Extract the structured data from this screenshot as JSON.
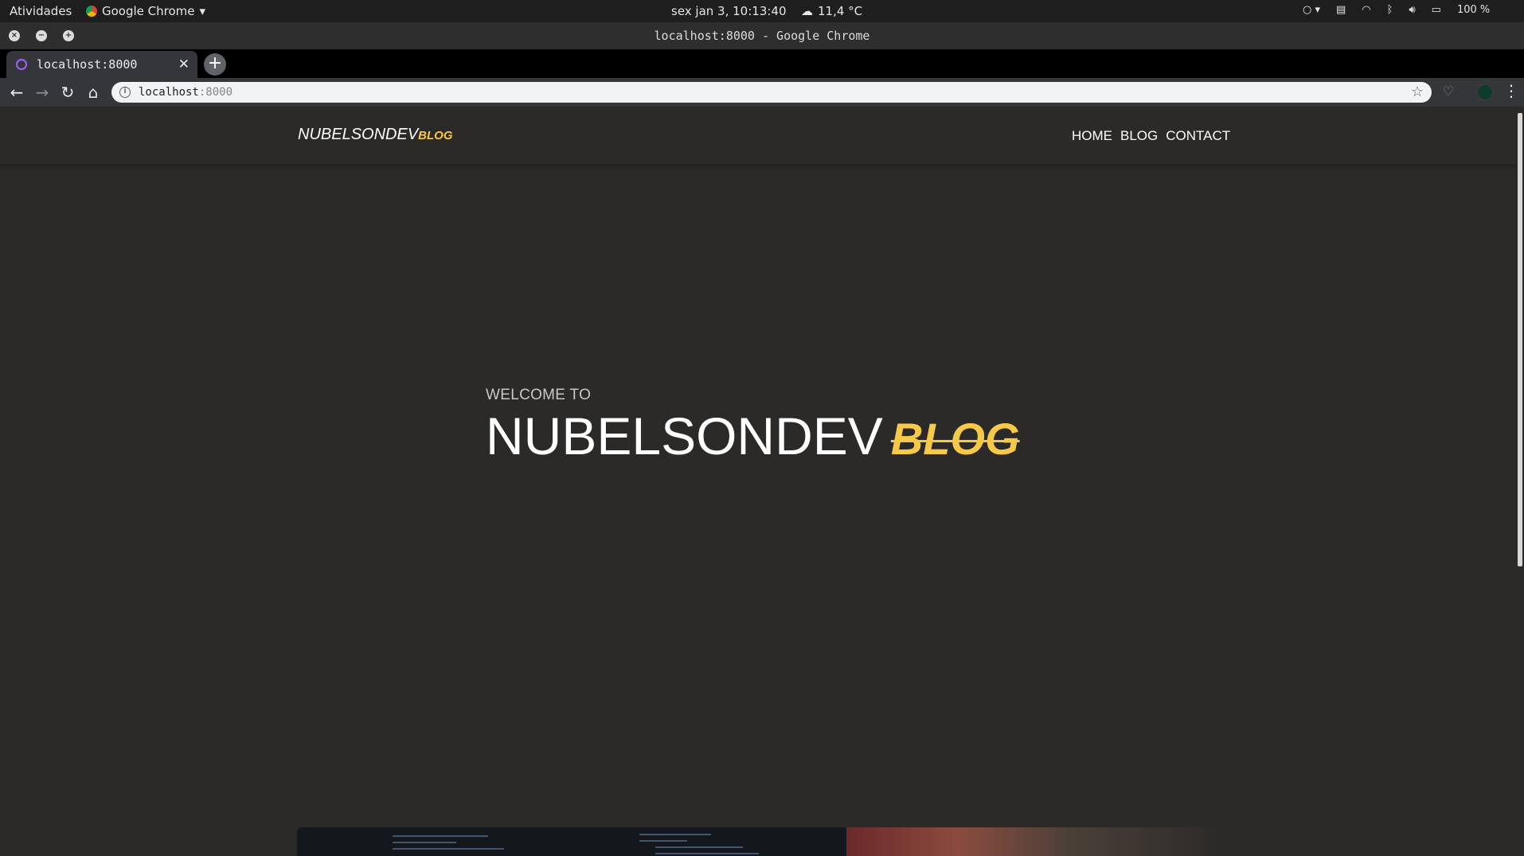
{
  "system_bar": {
    "activities": "Atividades",
    "app_name": "Google Chrome",
    "clock": "sex jan  3, 10:13:40",
    "weather": "11,4 °C",
    "battery": "100 %"
  },
  "window": {
    "title": "localhost:8000 - Google Chrome"
  },
  "tabs": [
    {
      "title": "localhost:8000"
    }
  ],
  "toolbar": {
    "url_host": "localhost",
    "url_port": ":8000"
  },
  "site": {
    "brand_main": "NUBELSONDEV",
    "brand_accent": "BLOG",
    "nav": [
      "HOME",
      "BLOG",
      "CONTACT"
    ],
    "hero": {
      "welcome": "WELCOME TO",
      "title_main": "NUBELSONDEV",
      "title_accent": "BLOG"
    }
  },
  "colors": {
    "page_bg": "#2b2a28",
    "accent": "#f7c948"
  }
}
